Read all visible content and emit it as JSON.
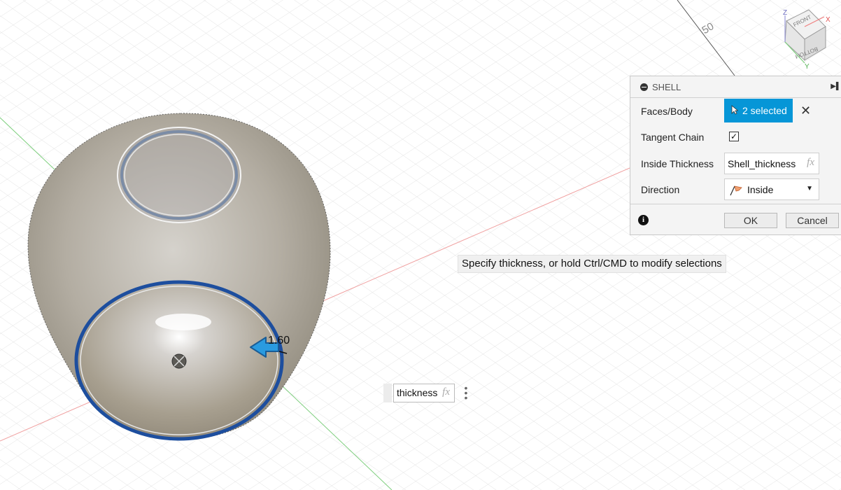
{
  "viewport": {
    "ruler_label": "50",
    "dimension_value": "1.60"
  },
  "viewcube": {
    "face_top": "FRONT",
    "face_side": "BOTTOM",
    "axis_z": "Z",
    "axis_x": "X",
    "axis_y": "Y"
  },
  "shell_dialog": {
    "title": "SHELL",
    "faces_body_label": "Faces/Body",
    "selection_label": "2 selected",
    "clear_symbol": "✕",
    "tangent_chain_label": "Tangent Chain",
    "tangent_chain_checked": true,
    "inside_thickness_label": "Inside Thickness",
    "inside_thickness_value": "Shell_thickness",
    "fx_label": "fx",
    "direction_label": "Direction",
    "direction_value": "Inside",
    "ok_label": "OK",
    "cancel_label": "Cancel",
    "accent_color": "#0696d7"
  },
  "tooltip": {
    "text": "Specify thickness, or hold Ctrl/CMD to modify selections"
  },
  "inline_input": {
    "value": "thickness",
    "fx_label": "fx"
  },
  "icons": {
    "minus": "circle-minus-icon",
    "expand": "expand-arrow-icon",
    "cursor": "cursor-arrow-icon",
    "close": "close-icon",
    "direction": "flag-direction-icon",
    "caret": "chevron-down-icon",
    "info": "info-icon",
    "more": "vertical-dots-icon",
    "drag_arrow": "drag-arrow-icon"
  }
}
